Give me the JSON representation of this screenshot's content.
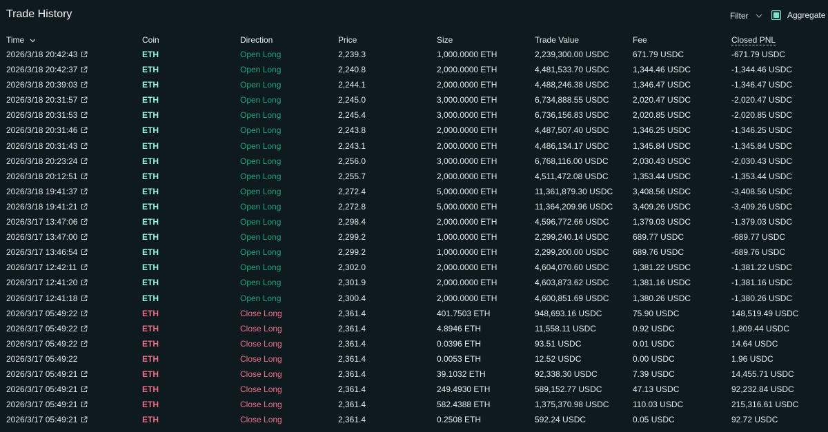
{
  "header": {
    "title": "Trade History",
    "filter_label": "Filter",
    "aggregate_label": "Aggregate"
  },
  "columns": [
    "Time",
    "Coin",
    "Direction",
    "Price",
    "Size",
    "Trade Value",
    "Fee",
    "Closed PNL"
  ],
  "colors": {
    "background": "#0f1a1f",
    "long_coin": "#97fce4",
    "long_direction": "#1fa67d",
    "short": "#ed7088",
    "accent": "#7fe0cc"
  },
  "rows": [
    {
      "time": "2026/3/18 20:42:43",
      "link": true,
      "coin": "ETH",
      "direction": "Open Long",
      "side": "long",
      "price": "2,239.3",
      "size": "1,000.0000 ETH",
      "value": "2,239,300.00 USDC",
      "fee": "671.79 USDC",
      "pnl": "-671.79 USDC"
    },
    {
      "time": "2026/3/18 20:42:37",
      "link": true,
      "coin": "ETH",
      "direction": "Open Long",
      "side": "long",
      "price": "2,240.8",
      "size": "2,000.0000 ETH",
      "value": "4,481,533.70 USDC",
      "fee": "1,344.46 USDC",
      "pnl": "-1,344.46 USDC"
    },
    {
      "time": "2026/3/18 20:39:03",
      "link": true,
      "coin": "ETH",
      "direction": "Open Long",
      "side": "long",
      "price": "2,244.1",
      "size": "2,000.0000 ETH",
      "value": "4,488,246.38 USDC",
      "fee": "1,346.47 USDC",
      "pnl": "-1,346.47 USDC"
    },
    {
      "time": "2026/3/18 20:31:57",
      "link": true,
      "coin": "ETH",
      "direction": "Open Long",
      "side": "long",
      "price": "2,245.0",
      "size": "3,000.0000 ETH",
      "value": "6,734,888.55 USDC",
      "fee": "2,020.47 USDC",
      "pnl": "-2,020.47 USDC"
    },
    {
      "time": "2026/3/18 20:31:53",
      "link": true,
      "coin": "ETH",
      "direction": "Open Long",
      "side": "long",
      "price": "2,245.4",
      "size": "3,000.0000 ETH",
      "value": "6,736,156.83 USDC",
      "fee": "2,020.85 USDC",
      "pnl": "-2,020.85 USDC"
    },
    {
      "time": "2026/3/18 20:31:46",
      "link": true,
      "coin": "ETH",
      "direction": "Open Long",
      "side": "long",
      "price": "2,243.8",
      "size": "2,000.0000 ETH",
      "value": "4,487,507.40 USDC",
      "fee": "1,346.25 USDC",
      "pnl": "-1,346.25 USDC"
    },
    {
      "time": "2026/3/18 20:31:43",
      "link": true,
      "coin": "ETH",
      "direction": "Open Long",
      "side": "long",
      "price": "2,243.1",
      "size": "2,000.0000 ETH",
      "value": "4,486,134.17 USDC",
      "fee": "1,345.84 USDC",
      "pnl": "-1,345.84 USDC"
    },
    {
      "time": "2026/3/18 20:23:24",
      "link": true,
      "coin": "ETH",
      "direction": "Open Long",
      "side": "long",
      "price": "2,256.0",
      "size": "3,000.0000 ETH",
      "value": "6,768,116.00 USDC",
      "fee": "2,030.43 USDC",
      "pnl": "-2,030.43 USDC"
    },
    {
      "time": "2026/3/18 20:12:51",
      "link": true,
      "coin": "ETH",
      "direction": "Open Long",
      "side": "long",
      "price": "2,255.7",
      "size": "2,000.0000 ETH",
      "value": "4,511,472.08 USDC",
      "fee": "1,353.44 USDC",
      "pnl": "-1,353.44 USDC"
    },
    {
      "time": "2026/3/18 19:41:37",
      "link": true,
      "coin": "ETH",
      "direction": "Open Long",
      "side": "long",
      "price": "2,272.4",
      "size": "5,000.0000 ETH",
      "value": "11,361,879.30 USDC",
      "fee": "3,408.56 USDC",
      "pnl": "-3,408.56 USDC"
    },
    {
      "time": "2026/3/18 19:41:21",
      "link": true,
      "coin": "ETH",
      "direction": "Open Long",
      "side": "long",
      "price": "2,272.8",
      "size": "5,000.0000 ETH",
      "value": "11,364,209.96 USDC",
      "fee": "3,409.26 USDC",
      "pnl": "-3,409.26 USDC"
    },
    {
      "time": "2026/3/17 13:47:06",
      "link": true,
      "coin": "ETH",
      "direction": "Open Long",
      "side": "long",
      "price": "2,298.4",
      "size": "2,000.0000 ETH",
      "value": "4,596,772.66 USDC",
      "fee": "1,379.03 USDC",
      "pnl": "-1,379.03 USDC"
    },
    {
      "time": "2026/3/17 13:47:00",
      "link": true,
      "coin": "ETH",
      "direction": "Open Long",
      "side": "long",
      "price": "2,299.2",
      "size": "1,000.0000 ETH",
      "value": "2,299,240.14 USDC",
      "fee": "689.77 USDC",
      "pnl": "-689.77 USDC"
    },
    {
      "time": "2026/3/17 13:46:54",
      "link": true,
      "coin": "ETH",
      "direction": "Open Long",
      "side": "long",
      "price": "2,299.2",
      "size": "1,000.0000 ETH",
      "value": "2,299,200.00 USDC",
      "fee": "689.76 USDC",
      "pnl": "-689.76 USDC"
    },
    {
      "time": "2026/3/17 12:42:11",
      "link": true,
      "coin": "ETH",
      "direction": "Open Long",
      "side": "long",
      "price": "2,302.0",
      "size": "2,000.0000 ETH",
      "value": "4,604,070.60 USDC",
      "fee": "1,381.22 USDC",
      "pnl": "-1,381.22 USDC"
    },
    {
      "time": "2026/3/17 12:41:20",
      "link": true,
      "coin": "ETH",
      "direction": "Open Long",
      "side": "long",
      "price": "2,301.9",
      "size": "2,000.0000 ETH",
      "value": "4,603,873.62 USDC",
      "fee": "1,381.16 USDC",
      "pnl": "-1,381.16 USDC"
    },
    {
      "time": "2026/3/17 12:41:18",
      "link": true,
      "coin": "ETH",
      "direction": "Open Long",
      "side": "long",
      "price": "2,300.4",
      "size": "2,000.0000 ETH",
      "value": "4,600,851.69 USDC",
      "fee": "1,380.26 USDC",
      "pnl": "-1,380.26 USDC"
    },
    {
      "time": "2026/3/17 05:49:22",
      "link": true,
      "coin": "ETH",
      "direction": "Close Long",
      "side": "short",
      "price": "2,361.4",
      "size": "401.7503 ETH",
      "value": "948,693.16 USDC",
      "fee": "75.90 USDC",
      "pnl": "148,519.49 USDC"
    },
    {
      "time": "2026/3/17 05:49:22",
      "link": true,
      "coin": "ETH",
      "direction": "Close Long",
      "side": "short",
      "price": "2,361.4",
      "size": "4.8946 ETH",
      "value": "11,558.11 USDC",
      "fee": "0.92 USDC",
      "pnl": "1,809.44 USDC"
    },
    {
      "time": "2026/3/17 05:49:22",
      "link": true,
      "coin": "ETH",
      "direction": "Close Long",
      "side": "short",
      "price": "2,361.4",
      "size": "0.0396 ETH",
      "value": "93.51 USDC",
      "fee": "0.01 USDC",
      "pnl": "14.64 USDC"
    },
    {
      "time": "2026/3/17 05:49:22",
      "link": false,
      "coin": "ETH",
      "direction": "Close Long",
      "side": "short",
      "price": "2,361.4",
      "size": "0.0053 ETH",
      "value": "12.52 USDC",
      "fee": "0.00 USDC",
      "pnl": "1.96 USDC"
    },
    {
      "time": "2026/3/17 05:49:21",
      "link": true,
      "coin": "ETH",
      "direction": "Close Long",
      "side": "short",
      "price": "2,361.4",
      "size": "39.1032 ETH",
      "value": "92,338.30 USDC",
      "fee": "7.39 USDC",
      "pnl": "14,455.71 USDC"
    },
    {
      "time": "2026/3/17 05:49:21",
      "link": true,
      "coin": "ETH",
      "direction": "Close Long",
      "side": "short",
      "price": "2,361.4",
      "size": "249.4930 ETH",
      "value": "589,152.77 USDC",
      "fee": "47.13 USDC",
      "pnl": "92,232.84 USDC"
    },
    {
      "time": "2026/3/17 05:49:21",
      "link": true,
      "coin": "ETH",
      "direction": "Close Long",
      "side": "short",
      "price": "2,361.4",
      "size": "582.4388 ETH",
      "value": "1,375,370.98 USDC",
      "fee": "110.03 USDC",
      "pnl": "215,316.61 USDC"
    },
    {
      "time": "2026/3/17 05:49:21",
      "link": true,
      "coin": "ETH",
      "direction": "Close Long",
      "side": "short",
      "price": "2,361.4",
      "size": "0.2508 ETH",
      "value": "592.24 USDC",
      "fee": "0.05 USDC",
      "pnl": "92.72 USDC"
    }
  ]
}
